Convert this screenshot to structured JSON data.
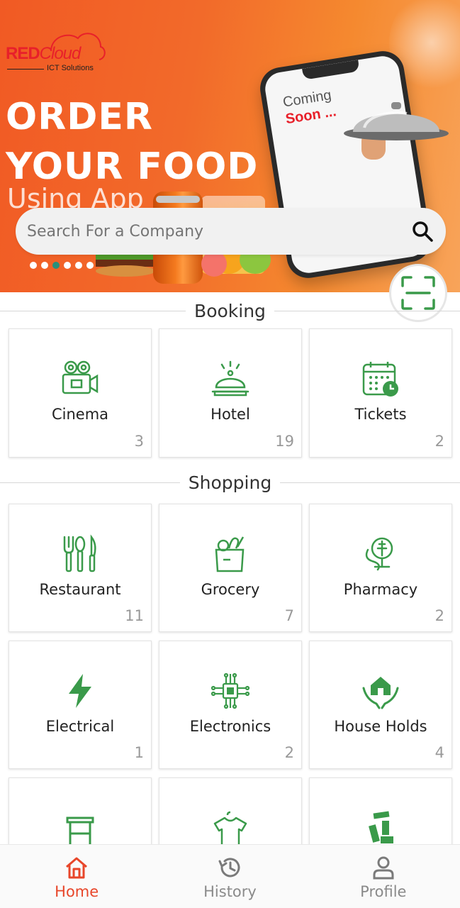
{
  "banner": {
    "logo_word1": "RED",
    "logo_word2": "Cloud",
    "logo_sub": "ICT Solutions",
    "headline_1": "ORDER",
    "headline_2": "YOUR FOOD",
    "headline_3": "Using App",
    "phone_line1": "Coming",
    "phone_line2": "Soon ...",
    "carousel_dots": 6,
    "carousel_active": 3
  },
  "search": {
    "placeholder": "Search For a Company"
  },
  "sections": {
    "booking": "Booking",
    "shopping": "Shopping"
  },
  "booking_items": [
    {
      "label": "Cinema",
      "count": "3",
      "icon": "movie-camera-icon"
    },
    {
      "label": "Hotel",
      "count": "19",
      "icon": "service-bell-icon"
    },
    {
      "label": "Tickets",
      "count": "2",
      "icon": "calendar-icon"
    }
  ],
  "shopping_items": [
    {
      "label": "Restaurant",
      "count": "11",
      "icon": "cutlery-icon"
    },
    {
      "label": "Grocery",
      "count": "7",
      "icon": "grocery-bag-icon"
    },
    {
      "label": "Pharmacy",
      "count": "2",
      "icon": "pharmacy-icon"
    },
    {
      "label": "Electrical",
      "count": "1",
      "icon": "lightning-icon"
    },
    {
      "label": "Electronics",
      "count": "2",
      "icon": "circuit-chip-icon"
    },
    {
      "label": "House Holds",
      "count": "4",
      "icon": "house-hands-icon"
    },
    {
      "label": "",
      "count": "",
      "icon": "furniture-table-icon"
    },
    {
      "label": "",
      "count": "",
      "icon": "shirt-hanger-icon"
    },
    {
      "label": "",
      "count": "",
      "icon": "tools-icon"
    }
  ],
  "nav": {
    "home": "Home",
    "history": "History",
    "profile": "Profile",
    "active": "home"
  },
  "colors": {
    "accent_green": "#3a9a4a",
    "active_nav": "#e8462a",
    "banner_orange": "#f26a2a"
  }
}
